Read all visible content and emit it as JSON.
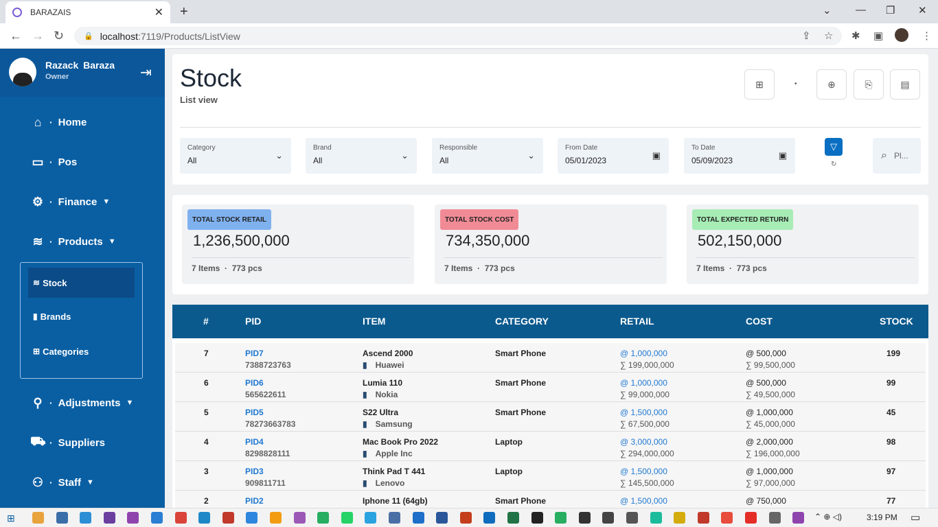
{
  "browser": {
    "tab_title": "BARAZAIS",
    "url_host": "localhost",
    "url_path": ":7119/Products/ListView"
  },
  "sidebar": {
    "user_name": "Razack  Baraza",
    "user_role": "Owner",
    "items": [
      {
        "label": "Home",
        "icon": "home-icon",
        "caret": false
      },
      {
        "label": "Pos",
        "icon": "monitor-icon",
        "caret": false
      },
      {
        "label": "Finance",
        "icon": "finance-icon",
        "caret": true
      },
      {
        "label": "Products",
        "icon": "layers-icon",
        "caret": true
      },
      {
        "label": "Adjustments",
        "icon": "adjustments-icon",
        "caret": true
      },
      {
        "label": "Suppliers",
        "icon": "truck-icon",
        "caret": false
      },
      {
        "label": "Staff",
        "icon": "users-icon",
        "caret": true
      }
    ],
    "subitems": [
      {
        "label": "Stock",
        "icon": "layers-icon",
        "active": true
      },
      {
        "label": "Brands",
        "icon": "bookmark-icon",
        "active": false
      },
      {
        "label": "Categories",
        "icon": "grid-icon",
        "active": false
      }
    ]
  },
  "header": {
    "title": "Stock",
    "subtitle": "List view"
  },
  "filters": [
    {
      "label": "Category",
      "value": "All",
      "type": "select"
    },
    {
      "label": "Brand",
      "value": "All",
      "type": "select"
    },
    {
      "label": "Responsible",
      "value": "All",
      "type": "select"
    },
    {
      "label": "From Date",
      "value": "05/01/2023",
      "type": "date"
    },
    {
      "label": "To Date",
      "value": "05/09/2023",
      "type": "date"
    }
  ],
  "search": {
    "placeholder": "Pl..."
  },
  "stats": [
    {
      "label": "TOTAL STOCK RETAIL",
      "amount": "1,236,500,000",
      "items": "7 Items",
      "pcs": "773 pcs",
      "color": "#7fb1ef"
    },
    {
      "label": "TOTAL STOCK COST",
      "amount": "734,350,000",
      "items": "7 Items",
      "pcs": "773 pcs",
      "color": "#f08b96"
    },
    {
      "label": "TOTAL EXPECTED RETURN",
      "amount": "502,150,000",
      "items": "7 Items",
      "pcs": "773 pcs",
      "color": "#a7ecb5"
    }
  ],
  "table": {
    "columns": [
      "#",
      "PID",
      "ITEM",
      "CATEGORY",
      "RETAIL",
      "COST",
      "STOCK"
    ],
    "rows": [
      {
        "num": "7",
        "pid": "PID7",
        "barcode": "7388723763",
        "item": "Ascend 2000",
        "brand": "Huawei",
        "category": "Smart Phone",
        "retail": "@ 1,000,000",
        "retail_total": "∑ 199,000,000",
        "cost": "@ 500,000",
        "cost_total": "∑ 99,500,000",
        "stock": "199"
      },
      {
        "num": "6",
        "pid": "PID6",
        "barcode": "565622611",
        "item": "Lumia 110",
        "brand": "Nokia",
        "category": "Smart Phone",
        "retail": "@ 1,000,000",
        "retail_total": "∑ 99,000,000",
        "cost": "@ 500,000",
        "cost_total": "∑ 49,500,000",
        "stock": "99"
      },
      {
        "num": "5",
        "pid": "PID5",
        "barcode": "78273663783",
        "item": "S22 Ultra",
        "brand": "Samsung",
        "category": "Smart Phone",
        "retail": "@ 1,500,000",
        "retail_total": "∑ 67,500,000",
        "cost": "@ 1,000,000",
        "cost_total": "∑ 45,000,000",
        "stock": "45"
      },
      {
        "num": "4",
        "pid": "PID4",
        "barcode": "8298828111",
        "item": "Mac Book Pro 2022",
        "brand": "Apple Inc",
        "category": "Laptop",
        "retail": "@ 3,000,000",
        "retail_total": "∑ 294,000,000",
        "cost": "@ 2,000,000",
        "cost_total": "∑ 196,000,000",
        "stock": "98"
      },
      {
        "num": "3",
        "pid": "PID3",
        "barcode": "909811711",
        "item": "Think Pad T 441",
        "brand": "Lenovo",
        "category": "Laptop",
        "retail": "@ 1,500,000",
        "retail_total": "∑ 145,500,000",
        "cost": "@ 1,000,000",
        "cost_total": "∑ 97,000,000",
        "stock": "97"
      },
      {
        "num": "2",
        "pid": "PID2",
        "barcode": "",
        "item": "Iphone 11 (64gb)",
        "brand": "",
        "category": "Smart Phone",
        "retail": "@ 1,500,000",
        "retail_total": "",
        "cost": "@ 750,000",
        "cost_total": "",
        "stock": "77"
      }
    ]
  },
  "taskbar": {
    "time": "3:19 PM"
  },
  "colors": {
    "sidebar": "#0a5fa3",
    "table_header": "#0b5a8e",
    "link": "#1f78d1"
  }
}
